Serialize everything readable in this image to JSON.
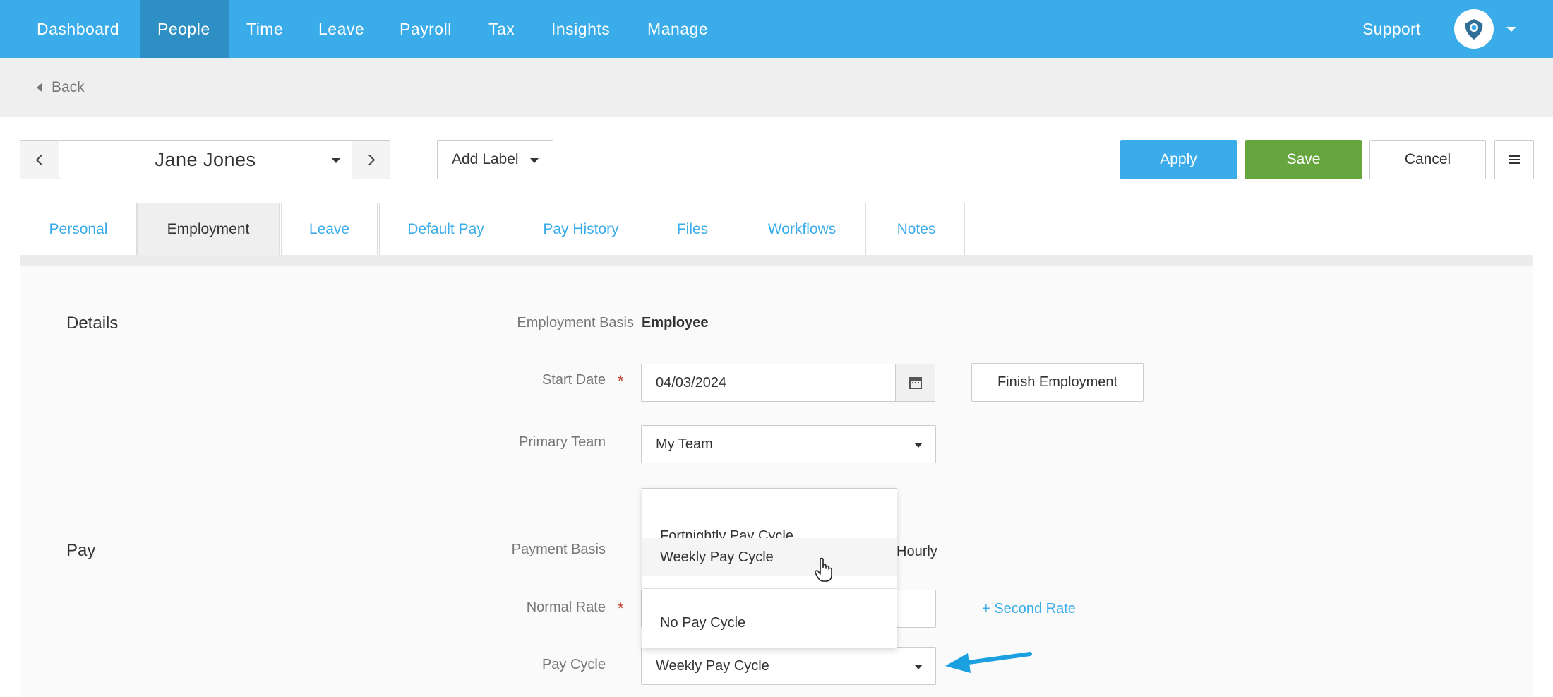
{
  "nav": {
    "items": [
      "Dashboard",
      "People",
      "Time",
      "Leave",
      "Payroll",
      "Tax",
      "Insights",
      "Manage"
    ],
    "active": "People",
    "support": "Support",
    "accent_color": "#3aace9"
  },
  "back": {
    "label": "Back"
  },
  "toolbar": {
    "employee_name": "Jane Jones",
    "add_label": "Add Label",
    "apply": "Apply",
    "save": "Save",
    "cancel": "Cancel"
  },
  "tabs": [
    "Personal",
    "Employment",
    "Leave",
    "Default Pay",
    "Pay History",
    "Files",
    "Workflows",
    "Notes"
  ],
  "active_tab": "Employment",
  "details": {
    "title": "Details",
    "employment_basis_label": "Employment Basis",
    "employment_basis_value": "Employee",
    "start_date_label": "Start Date",
    "start_date_value": "04/03/2024",
    "finish_employment": "Finish Employment",
    "primary_team_label": "Primary Team",
    "primary_team_value": "My Team"
  },
  "pay": {
    "title": "Pay",
    "payment_basis_label": "Payment Basis",
    "payment_basis_value": "Hourly",
    "normal_rate_label": "Normal Rate",
    "second_rate_link": "+ Second Rate",
    "pay_cycle_label": "Pay Cycle",
    "pay_cycle_value": "Weekly Pay Cycle"
  },
  "pay_cycle_dropdown": {
    "options": [
      "Fortnightly Pay Cycle",
      "Weekly Pay Cycle",
      "No Pay Cycle"
    ],
    "hovered": "Weekly Pay Cycle"
  },
  "required_marker": "*",
  "colors": {
    "apply": "#3aace9",
    "save": "#67a53e",
    "arrow": "#1aa0e0"
  }
}
